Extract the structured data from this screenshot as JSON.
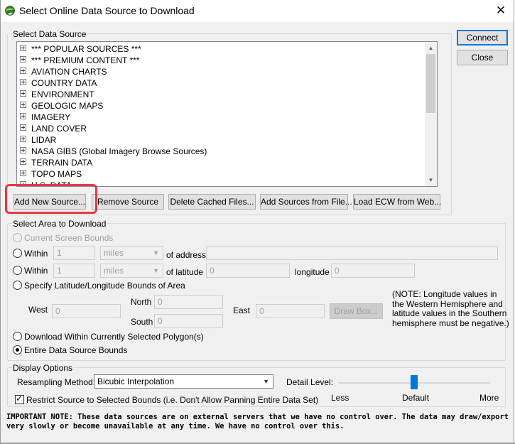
{
  "window": {
    "title": "Select Online Data Source to Download",
    "close_glyph": "✕"
  },
  "data_source": {
    "group_label": "Select Data Source",
    "tree_items": [
      "*** POPULAR SOURCES ***",
      "*** PREMIUM CONTENT ***",
      "AVIATION CHARTS",
      "COUNTRY DATA",
      "ENVIRONMENT",
      "GEOLOGIC MAPS",
      "IMAGERY",
      "LAND COVER",
      "LIDAR",
      "NASA GIBS (Global Imagery Browse Sources)",
      "TERRAIN DATA",
      "TOPO MAPS",
      "U.S. DATA"
    ],
    "buttons": {
      "add_new": "Add New Source...",
      "remove": "Remove Source",
      "delete_cached": "Delete Cached Files...",
      "add_from_file": "Add Sources from File...",
      "load_ecw": "Load ECW from Web..."
    }
  },
  "side_buttons": {
    "connect": "Connect",
    "close": "Close"
  },
  "area": {
    "group_label": "Select Area to Download",
    "current_screen": "Current Screen Bounds",
    "within_label": "Within",
    "within_address": {
      "distance": "1",
      "unit": "miles",
      "of_label": "of address",
      "address": ""
    },
    "within_latlon": {
      "distance": "1",
      "unit": "miles",
      "of_label": "of latitude",
      "latitude": "0",
      "longitude_label": "longitude",
      "longitude": "0"
    },
    "specify_bounds": "Specify Latitude/Longitude Bounds of Area",
    "bounds": {
      "west_label": "West",
      "west": "0",
      "north_label": "North",
      "north": "0",
      "south_label": "South",
      "south": "0",
      "east_label": "East",
      "east": "0",
      "draw_box": "Draw Box..."
    },
    "longitude_note": "(NOTE: Longitude values in the Western Hemisphere and latitude values in the Southern hemisphere must be negative.)",
    "within_polygon": "Download Within Currently Selected Polygon(s)",
    "entire_bounds": "Entire Data Source Bounds",
    "selected_option": "entire_bounds"
  },
  "display": {
    "group_label": "Display Options",
    "resampling_label": "Resampling Method:",
    "resampling_value": "Bicubic Interpolation",
    "detail_label": "Detail Level:",
    "detail_less": "Less",
    "detail_default": "Default",
    "detail_more": "More",
    "detail_level": 0.5,
    "restrict_label": "Restrict Source to Selected Bounds (i.e. Don't Allow Panning Entire Data Set)",
    "restrict_checked": true
  },
  "important_note": "IMPORTANT NOTE: These data sources are on external servers that we have no control over. The data may draw/export very slowly or become unavailable at any time. We have no control over this.",
  "colors": {
    "accent": "#0078d7",
    "highlight_annotation": "#e53945"
  }
}
